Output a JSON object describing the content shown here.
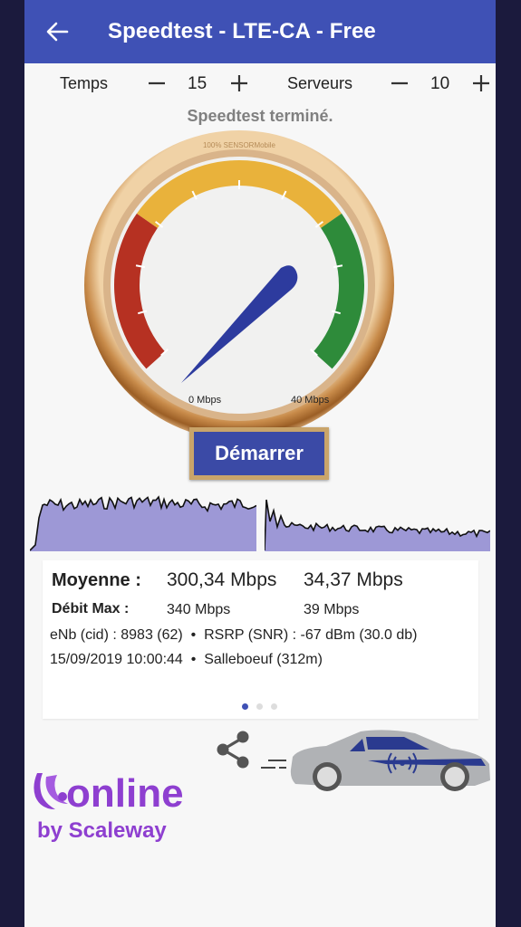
{
  "app": {
    "title": "Speedtest - LTE-CA - Free",
    "back_icon": "arrow-back-icon"
  },
  "controls": {
    "time_label": "Temps",
    "time_value": "15",
    "servers_label": "Serveurs",
    "servers_value": "10"
  },
  "status_text": "Speedtest terminé.",
  "gauge": {
    "brand_text": "100% SENSORMobile",
    "min_label": "0 Mbps",
    "max_label": "40 Mbps",
    "needle_value_mbps": 34.37,
    "zone_colors": [
      "#b63122",
      "#e9b23b",
      "#2e8b3a"
    ],
    "needle_color": "#2d3b9e"
  },
  "start_button_label": "Démarrer",
  "results": {
    "avg_label": "Moyenne :",
    "avg_download": "300,34 Mbps",
    "avg_upload": "34,37 Mbps",
    "max_label": "Débit Max :",
    "max_download": "340 Mbps",
    "max_upload": "39 Mbps",
    "cell_line": "eNb (cid) : 8983 (62)  •  RSRP (SNR) : -67 dBm (30.0 db)",
    "date_line": "15/09/2019 10:00:44  •  Salleboeuf (312m)",
    "page_indicator": {
      "count": 3,
      "active": 0
    }
  },
  "branding": {
    "logo_word": "online",
    "logo_sub": "by Scaleway",
    "share_icon": "share-icon",
    "car_icon": "car-icon",
    "signal_icon": "wireless-signal-icon"
  },
  "colors": {
    "accent": "#3f51b5",
    "graph_fill": "#9d98d6",
    "logo_purple": "#8e3fd0"
  }
}
